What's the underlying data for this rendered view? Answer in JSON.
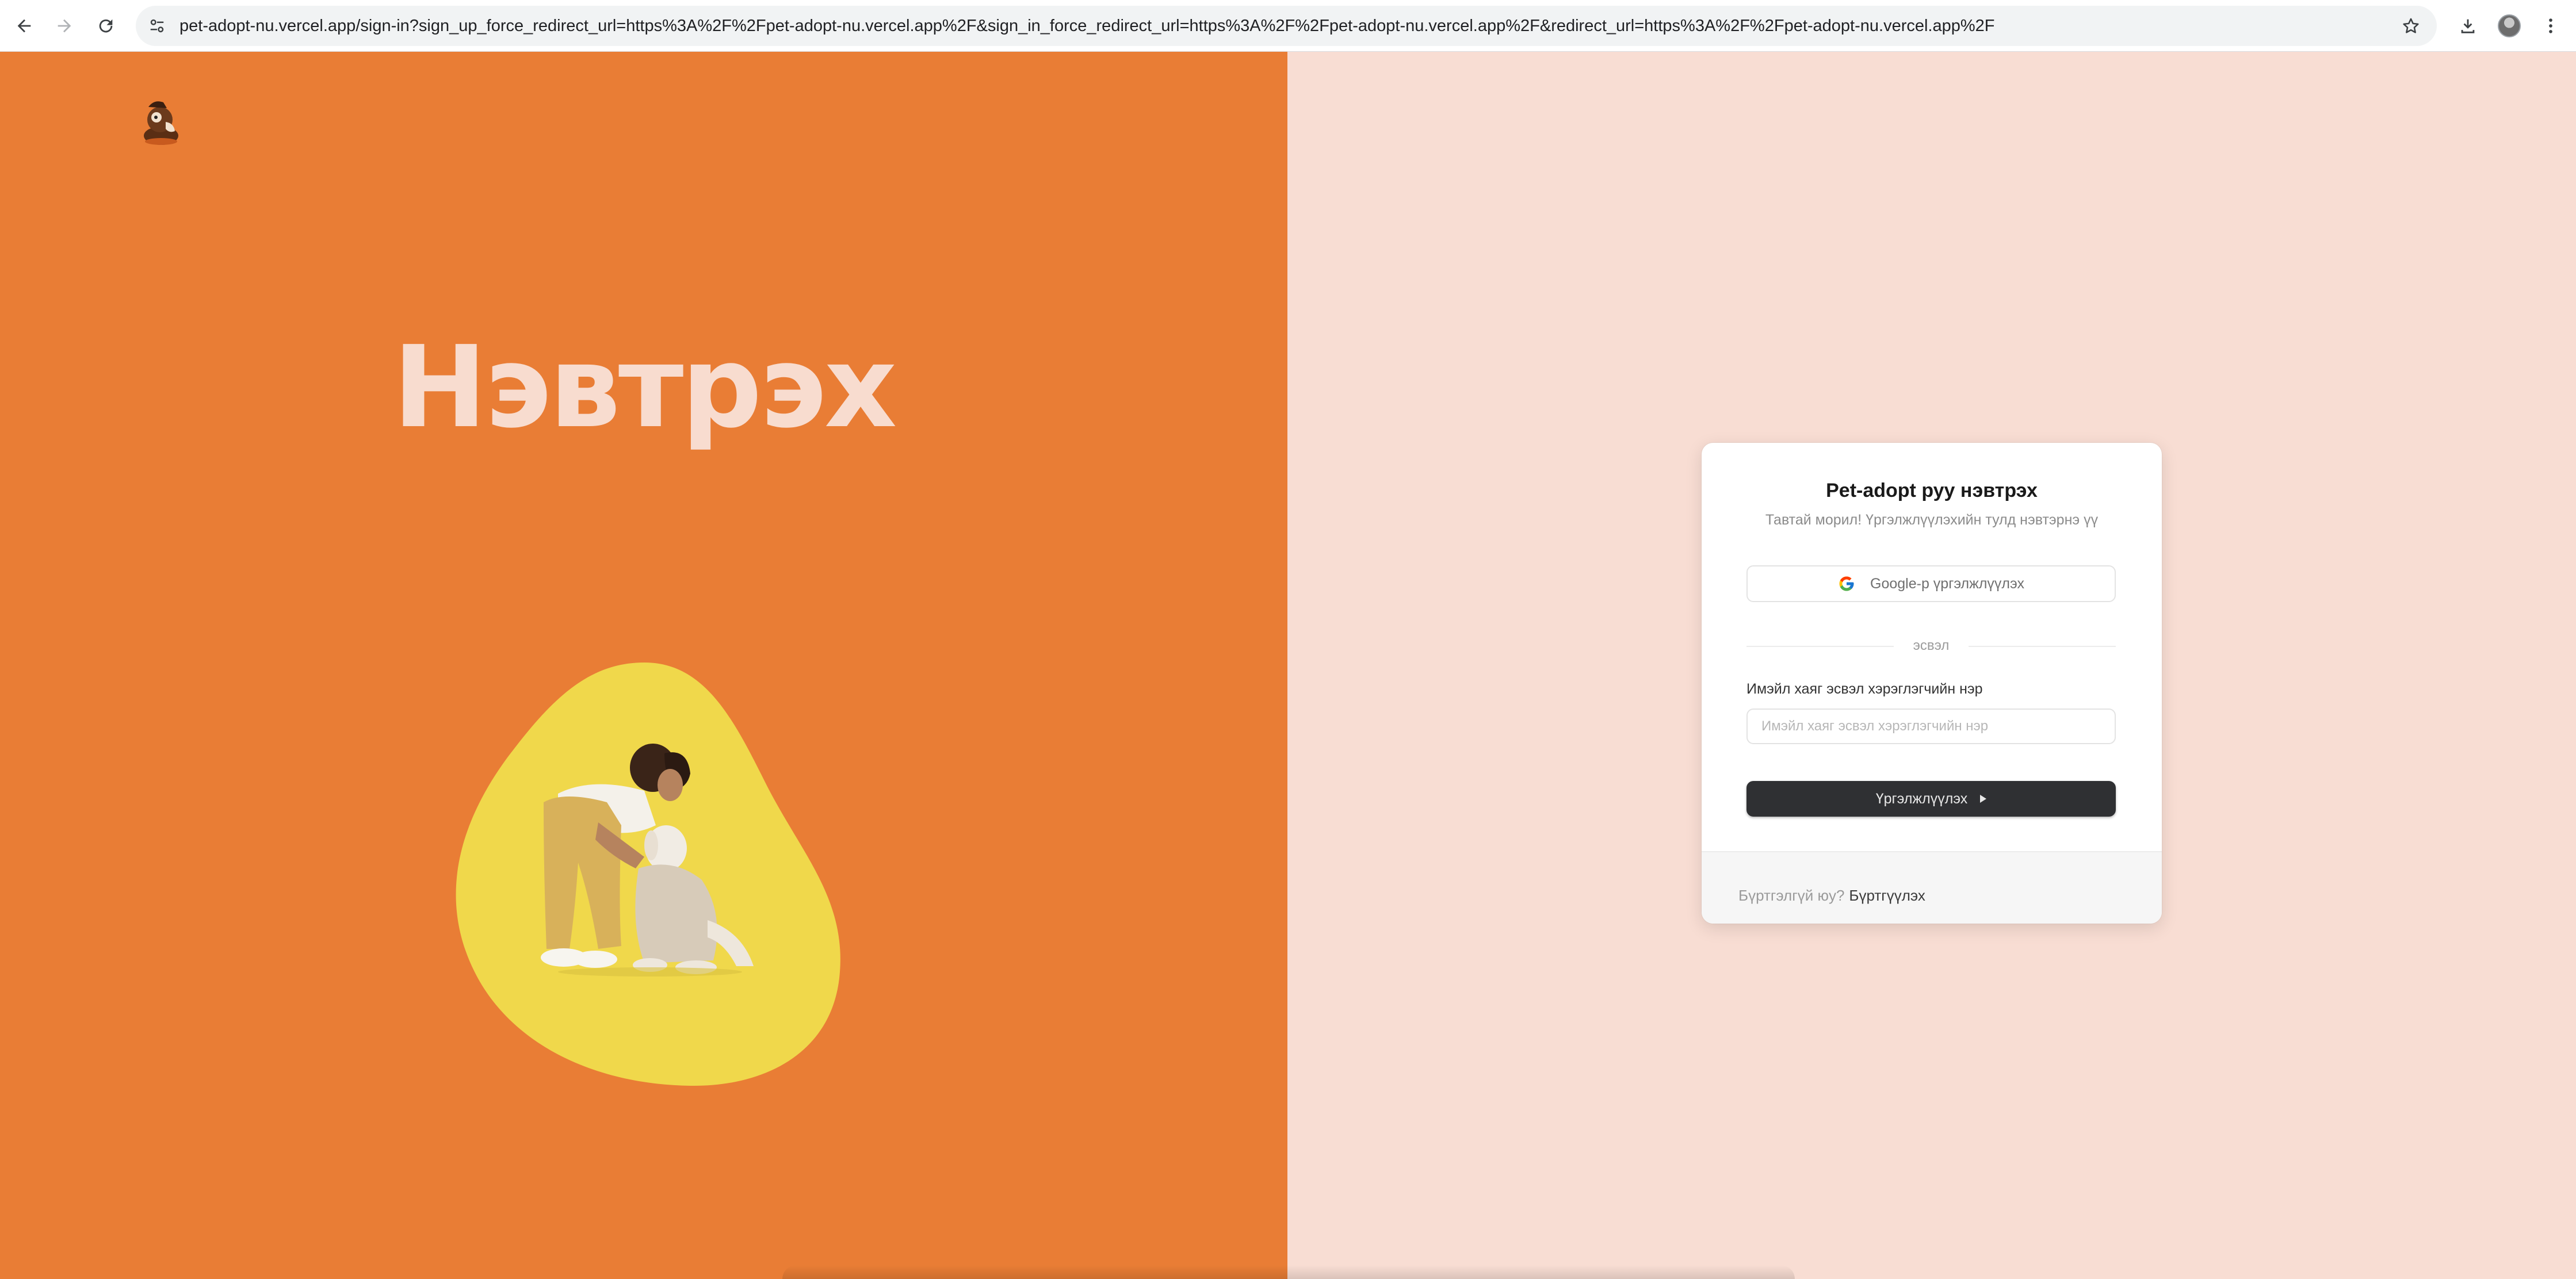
{
  "browser": {
    "url": "pet-adopt-nu.vercel.app/sign-in?sign_up_force_redirect_url=https%3A%2F%2Fpet-adopt-nu.vercel.app%2F&sign_in_force_redirect_url=https%3A%2F%2Fpet-adopt-nu.vercel.app%2F&redirect_url=https%3A%2F%2Fpet-adopt-nu.vercel.app%2F",
    "icons": [
      "back-arrow-icon",
      "forward-arrow-icon",
      "reload-icon",
      "site-info-icon",
      "bookmark-star-icon",
      "download-icon",
      "profile-avatar",
      "kebab-menu-icon"
    ]
  },
  "hero": {
    "title": "Нэвтрэх",
    "colors": {
      "background": "#e97d35",
      "title": "#f8dccf",
      "blob": "#f0d84b"
    }
  },
  "signin": {
    "title": "Pet-adopt руу нэвтрэх",
    "subtitle": "Тавтай морил! Үргэлжлүүлэхийн тулд нэвтэрнэ үү",
    "google_button": "Google-р үргэлжлүүлэх",
    "divider": "эсвэл",
    "identifier_label": "Имэйл хаяг эсвэл хэрэглэгчийн нэр",
    "identifier_placeholder": "Имэйл хаяг эсвэл хэрэглэгчийн нэр",
    "identifier_value": "",
    "continue_button": "Үргэлжлүүлэх",
    "footer_text": "Бүртгэлгүй юу?",
    "footer_link": "Бүртгүүлэх",
    "colors": {
      "panel_background": "#f8ddd3",
      "primary_button": "#2f3033"
    }
  }
}
